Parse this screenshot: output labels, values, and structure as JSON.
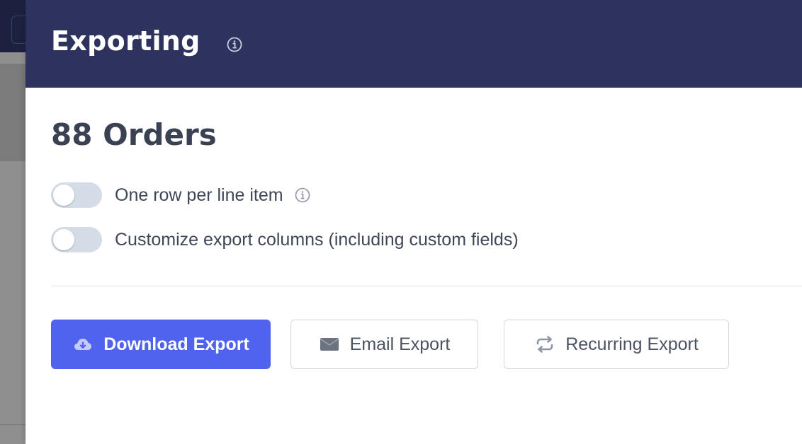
{
  "panel": {
    "title": "Exporting",
    "count_heading": "88 Orders"
  },
  "options": [
    {
      "label": "One row per line item",
      "enabled": false,
      "has_info": true
    },
    {
      "label": "Customize export columns (including custom fields)",
      "enabled": false,
      "has_info": false
    }
  ],
  "actions": {
    "download_label": "Download Export",
    "email_label": "Email Export",
    "recurring_label": "Recurring Export"
  },
  "icons": {
    "info": "info-circle-icon",
    "download": "cloud-download-icon",
    "email": "envelope-icon",
    "recurring": "repeat-arrows-icon"
  },
  "colors": {
    "header_bg": "#2e335e",
    "primary_button": "#4f63ef",
    "toggle_off": "#d4dde7",
    "heading_text": "#3a4152"
  }
}
